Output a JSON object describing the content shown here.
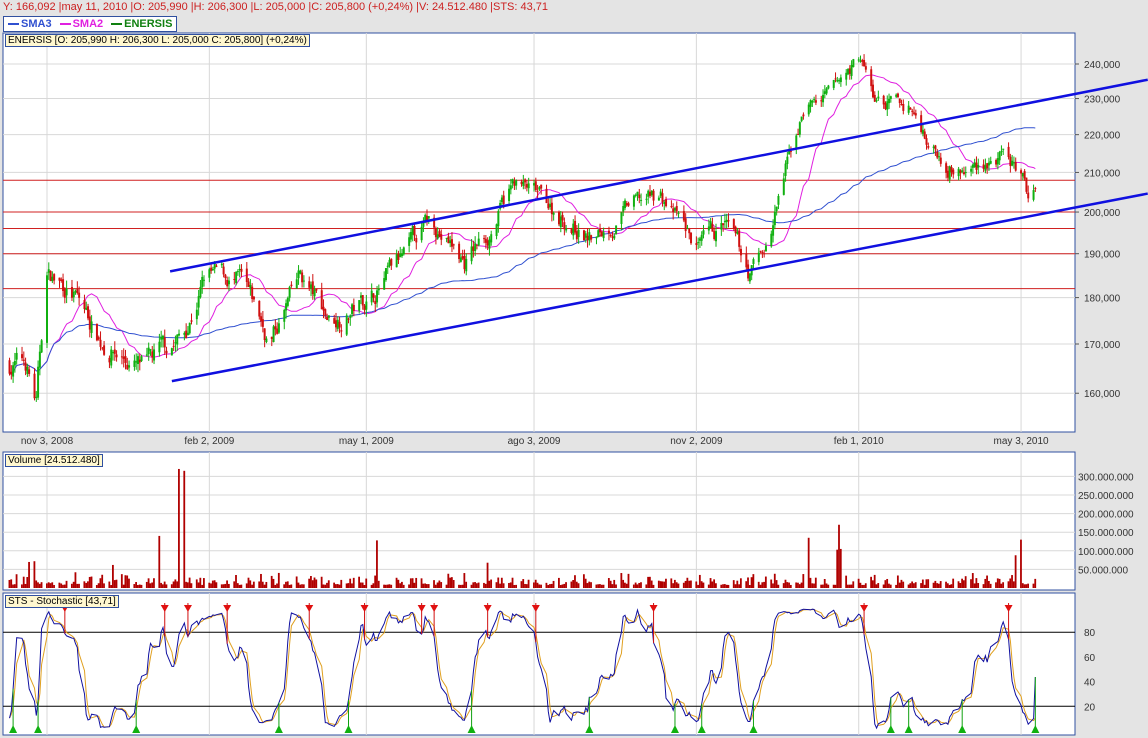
{
  "status": {
    "text": "Y: 166,092 |may 11, 2010 |O: 205,990 |H: 206,300 |L: 205,000 |C: 205,800 (+0,24%) |V: 24.512.480 |STS: 43,71"
  },
  "legend": [
    {
      "label": "SMA3",
      "color": "#3050d0"
    },
    {
      "label": "SMA2",
      "color": "#e020e0"
    },
    {
      "label": "ENERSIS",
      "color": "#108010"
    }
  ],
  "price_panel": {
    "info": "ENERSIS [O: 205,990  H: 206,300  L: 205,000  C: 205,800] (+0,24%)"
  },
  "volume_panel": {
    "info": "Volume [24.512.480]"
  },
  "stoch_panel": {
    "info": "STS - Stochastic [43,71]"
  },
  "chart_data": {
    "type": "candlestick",
    "symbol": "ENERSIS",
    "scale": "log",
    "ylim": [
      152000,
      248000
    ],
    "price_ticks": [
      {
        "v": 240000,
        "label": "240,000"
      },
      {
        "v": 230000,
        "label": "230,000"
      },
      {
        "v": 220000,
        "label": "220,000"
      },
      {
        "v": 210000,
        "label": "210,000"
      },
      {
        "v": 200000,
        "label": "200,000"
      },
      {
        "v": 190000,
        "label": "190,000"
      },
      {
        "v": 180000,
        "label": "180,000"
      },
      {
        "v": 170000,
        "label": "170,000"
      },
      {
        "v": 160000,
        "label": "160,000"
      }
    ],
    "date_ticks": [
      {
        "d": "2008-11-03",
        "label": "nov 3, 2008"
      },
      {
        "d": "2009-02-02",
        "label": "feb 2, 2009"
      },
      {
        "d": "2009-05-01",
        "label": "may 1, 2009"
      },
      {
        "d": "2009-08-03",
        "label": "ago 3, 2009"
      },
      {
        "d": "2009-11-02",
        "label": "nov 2, 2009"
      },
      {
        "d": "2010-02-01",
        "label": "feb 1, 2010"
      },
      {
        "d": "2010-05-03",
        "label": "may 3, 2010"
      }
    ],
    "close_anchors": [
      [
        "2008-10-13",
        166000
      ],
      [
        "2008-10-22",
        166000
      ],
      [
        "2008-10-28",
        158000
      ],
      [
        "2008-11-03",
        185000
      ],
      [
        "2008-11-16",
        182000
      ],
      [
        "2008-12-03",
        171000
      ],
      [
        "2008-12-28",
        164000
      ],
      [
        "2009-01-19",
        172000
      ],
      [
        "2009-01-31",
        185000
      ],
      [
        "2009-02-19",
        183000
      ],
      [
        "2009-03-08",
        170000
      ],
      [
        "2009-03-25",
        184000
      ],
      [
        "2009-04-11",
        175000
      ],
      [
        "2009-05-03",
        180000
      ],
      [
        "2009-05-25",
        190000
      ],
      [
        "2009-06-06",
        198000
      ],
      [
        "2009-06-25",
        188000
      ],
      [
        "2009-07-09",
        195000
      ],
      [
        "2009-07-23",
        207000
      ],
      [
        "2009-08-09",
        202000
      ],
      [
        "2009-09-06",
        193000
      ],
      [
        "2009-09-26",
        201000
      ],
      [
        "2009-10-13",
        204000
      ],
      [
        "2009-11-04",
        190000
      ],
      [
        "2009-11-18",
        196000
      ],
      [
        "2009-12-02",
        185000
      ],
      [
        "2009-12-13",
        193000
      ],
      [
        "2009-12-22",
        210000
      ],
      [
        "2010-01-02",
        228000
      ],
      [
        "2010-01-16",
        230000
      ],
      [
        "2010-02-02",
        242000
      ],
      [
        "2010-02-10",
        229000
      ],
      [
        "2010-03-02",
        227000
      ],
      [
        "2010-03-16",
        216000
      ],
      [
        "2010-04-02",
        210000
      ],
      [
        "2010-04-16",
        214000
      ],
      [
        "2010-05-02",
        210000
      ],
      [
        "2010-05-07",
        203000
      ],
      [
        "2010-05-11",
        205800
      ]
    ],
    "last_bar": {
      "date": "2010-05-11",
      "open": 205990,
      "high": 206300,
      "low": 205000,
      "close": 205800,
      "volume": 24512480
    },
    "sma_periods": {
      "SMA2": 20,
      "SMA3": 100
    },
    "trendlines": [
      {
        "from": [
          "2009-01-11",
          185900
        ],
        "to": [
          "2010-07-13",
          235400
        ],
        "color": "#1010e0"
      },
      {
        "from": [
          "2009-01-12",
          162400
        ],
        "to": [
          "2010-07-13",
          204600
        ],
        "color": "#1010e0"
      }
    ],
    "horizontal_levels": [
      208000,
      200000,
      196000,
      190000,
      182000
    ],
    "volume": {
      "ticks": [
        {
          "v": 300000000,
          "label": "300.000.000"
        },
        {
          "v": 250000000,
          "label": "250.000.000"
        },
        {
          "v": 200000000,
          "label": "200.000.000"
        },
        {
          "v": 150000000,
          "label": "150.000.000"
        },
        {
          "v": 100000000,
          "label": "100.000.000"
        },
        {
          "v": 50000000,
          "label": "50.000.000"
        }
      ],
      "spikes": [
        [
          "2008-10-24",
          70000000
        ],
        [
          "2008-10-27",
          72000000
        ],
        [
          "2008-12-10",
          62000000
        ],
        [
          "2009-01-05",
          140000000
        ],
        [
          "2009-01-16",
          320000000
        ],
        [
          "2009-01-19",
          315000000
        ],
        [
          "2009-05-07",
          128000000
        ],
        [
          "2009-07-08",
          68000000
        ],
        [
          "2010-01-04",
          135000000
        ],
        [
          "2010-01-20",
          103000000
        ],
        [
          "2010-01-21",
          170000000
        ],
        [
          "2010-01-22",
          105000000
        ],
        [
          "2010-05-03",
          130000000
        ],
        [
          "2010-04-30",
          88000000
        ]
      ]
    },
    "stochastic": {
      "k_period": 14,
      "smooth": 3,
      "d_period": 3,
      "levels": [
        80,
        20
      ],
      "ticks": [
        80,
        60,
        40,
        20
      ],
      "last": 43.71
    }
  }
}
